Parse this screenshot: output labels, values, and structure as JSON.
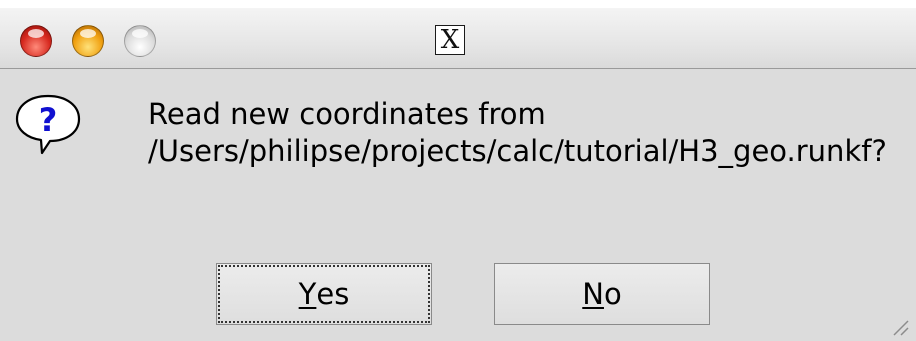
{
  "window": {
    "title_icon": "x11-logo-icon",
    "title_glyph": "X",
    "traffic_lights": [
      {
        "name": "close",
        "color": "#d6281e"
      },
      {
        "name": "minimize",
        "color": "#f0a010"
      },
      {
        "name": "zoom",
        "color": "#dcdcdc"
      }
    ]
  },
  "dialog": {
    "icon": "question-bubble-icon",
    "icon_glyph": "?",
    "icon_color": "#1010d0",
    "message": "Read new coordinates from\n/Users/philipse/projects/calc/tutorial/H3_geo.runkf?"
  },
  "buttons": {
    "yes": {
      "mnemonic": "Y",
      "rest": "es"
    },
    "no": {
      "mnemonic": "N",
      "rest": "o"
    }
  }
}
